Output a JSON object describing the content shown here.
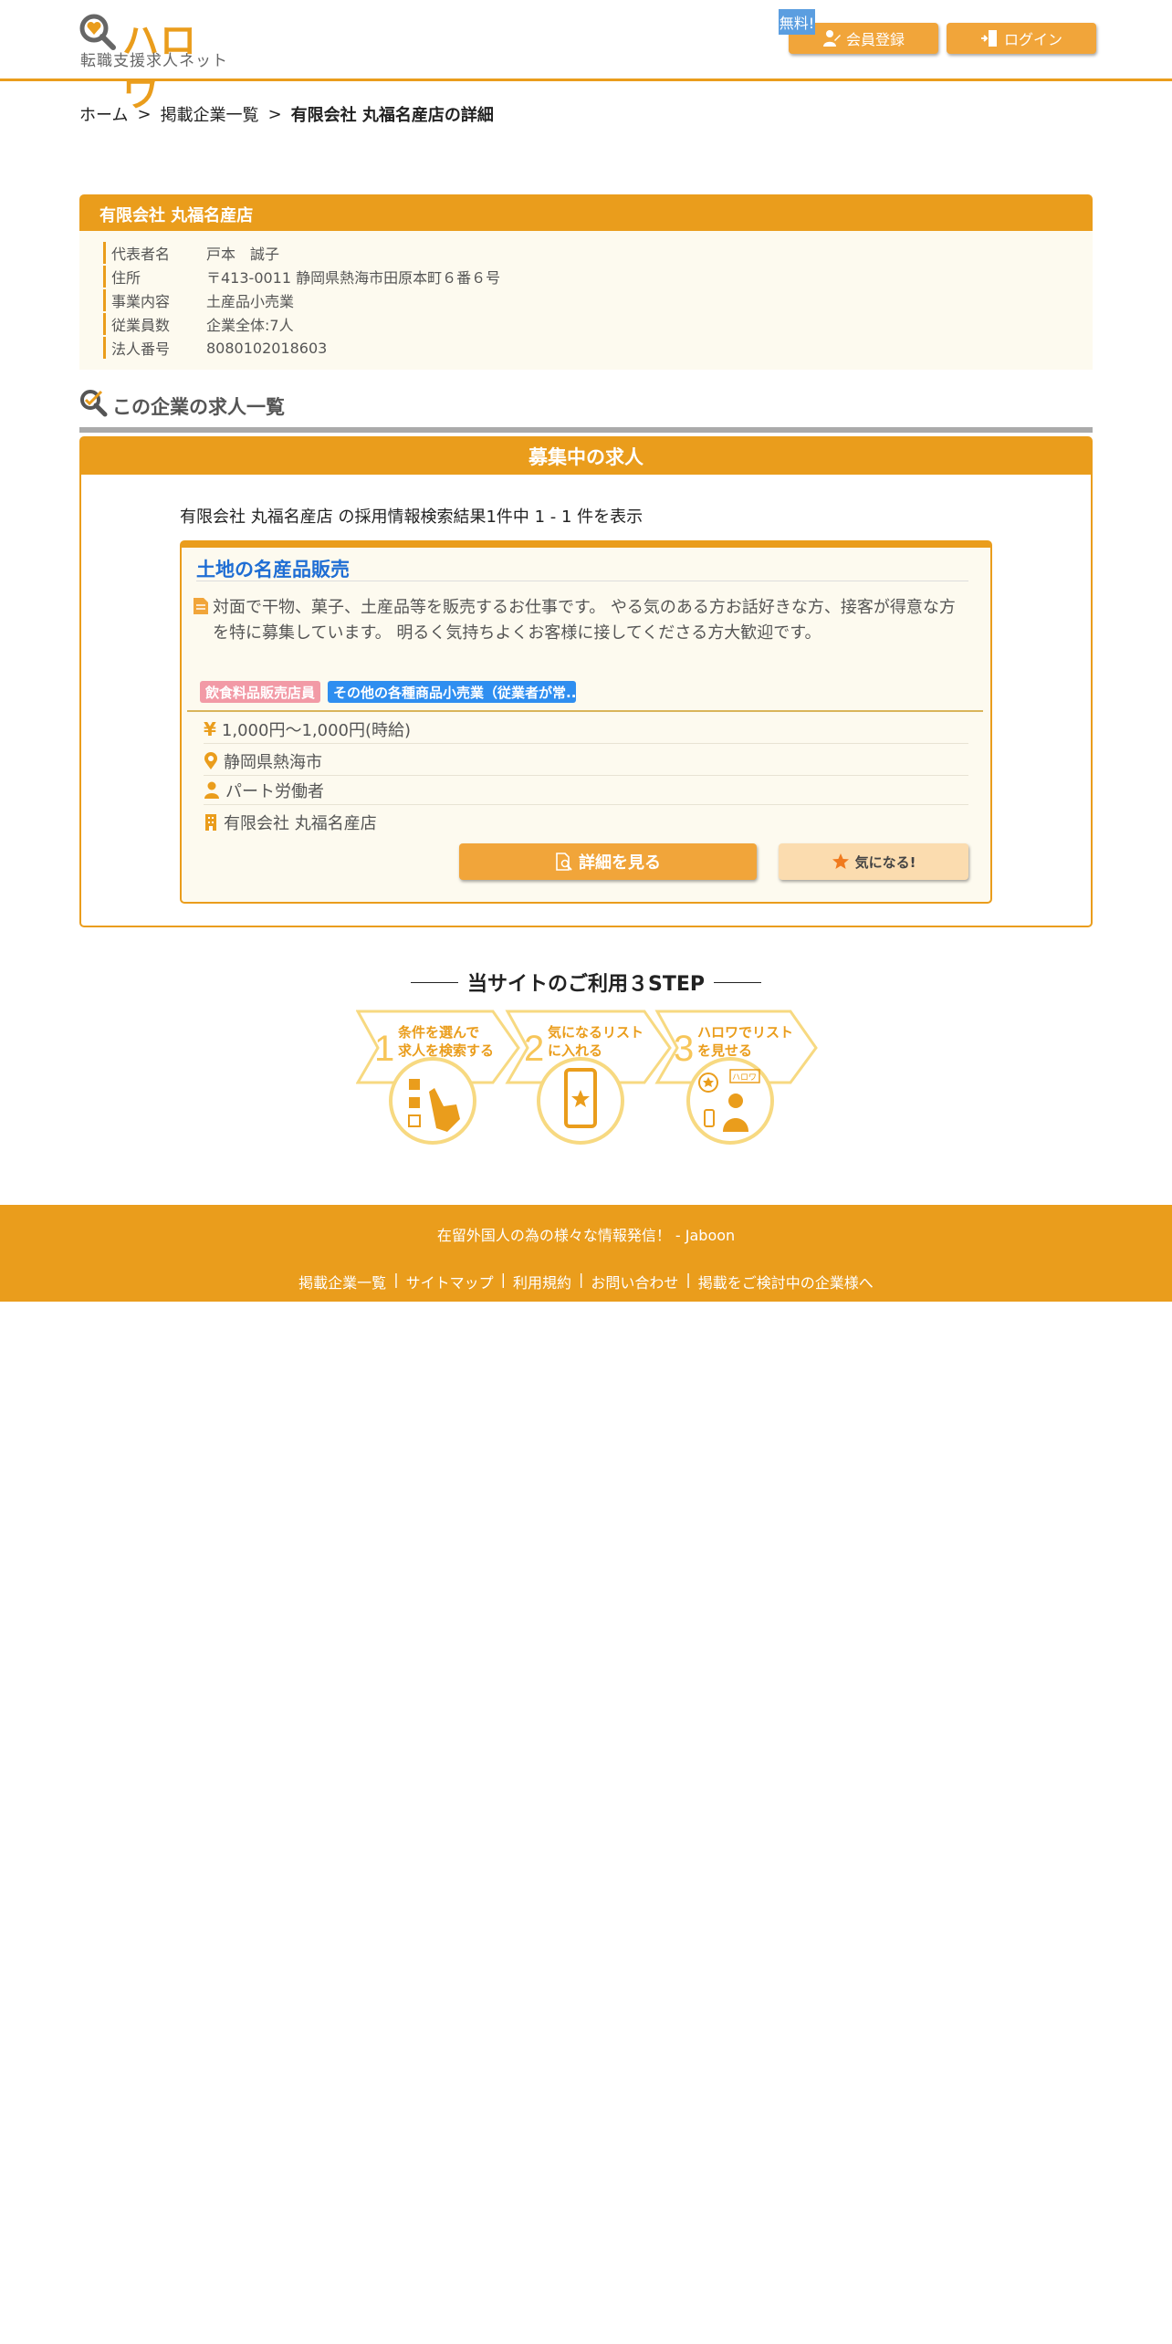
{
  "header": {
    "logo_main": "ハロワ",
    "logo_sub": "転職支援求人ネット",
    "free_badge": "無料!",
    "register_label": "会員登録",
    "login_label": "ログイン"
  },
  "breadcrumb": {
    "items": [
      "ホーム",
      "掲載企業一覧"
    ],
    "separator": ">",
    "current": "有限会社 丸福名産店の詳細"
  },
  "company": {
    "name": "有限会社 丸福名産店",
    "rows": [
      {
        "label": "代表者名",
        "value": "戸本　誠子"
      },
      {
        "label": "住所",
        "value": "〒413-0011 静岡県熱海市田原本町６番６号"
      },
      {
        "label": "事業内容",
        "value": "土産品小売業"
      },
      {
        "label": "従業員数",
        "value": "企業全体:7人"
      },
      {
        "label": "法人番号",
        "value": "8080102018603"
      }
    ]
  },
  "jobs_section": {
    "title": "この企業の求人一覧",
    "frame_title": "募集中の求人",
    "result_text": "有限会社 丸福名産店  の採用情報検索結果1件中 1 - 1 件を表示"
  },
  "job": {
    "title": "土地の名産品販売",
    "description": "対面で干物、菓子、土産品等を販売するお仕事です。 やる気のある方お話好きな方、接客が得意な方を特に募集しています。 明るく気持ちよくお客様に接してくださる方大歓迎です。",
    "tags": [
      "飲食料品販売店員",
      "その他の各種商品小売業（従業者が常..."
    ],
    "wage": "1,000円～1,000円(時給)",
    "location": "静岡県熱海市",
    "employment": "パート労働者",
    "company": "有限会社 丸福名産店",
    "detail_button": "詳細を見る",
    "fav_button": "気になる!"
  },
  "steps": {
    "title": "当サイトのご利用３STEP",
    "items": [
      {
        "num": "1",
        "line1": "条件を選んで",
        "line2": "求人を検索する"
      },
      {
        "num": "2",
        "line1": "気になるリスト",
        "line2": "に入れる"
      },
      {
        "num": "3",
        "line1": "ハロワでリスト",
        "line2": "を見せる"
      }
    ],
    "badge_text": "ハロワ"
  },
  "footer": {
    "message": "在留外国人の為の様々な情報発信！ - Jaboon",
    "links": [
      "掲載企業一覧",
      "サイトマップ",
      "利用規約",
      "お問い合わせ",
      "掲載をご検討中の企業様へ"
    ],
    "separator": "|"
  },
  "colors": {
    "accent": "#ea9d1c",
    "button": "#f1a53a",
    "link_blue": "#1f6ed4",
    "tag_pink": "#f29aa6",
    "tag_blue": "#2f8ef0",
    "badge_blue": "#5b9ee0",
    "panel_bg": "#fdfaef"
  },
  "icons": {
    "logo": "magnifier-heart-icon",
    "register": "user-add-icon",
    "login": "door-enter-icon",
    "section": "magnifier-check-icon",
    "description": "document-icon",
    "wage": "yen-icon",
    "location": "map-pin-icon",
    "employment": "person-icon",
    "company": "building-icon",
    "detail": "document-search-icon",
    "fav": "star-icon"
  }
}
